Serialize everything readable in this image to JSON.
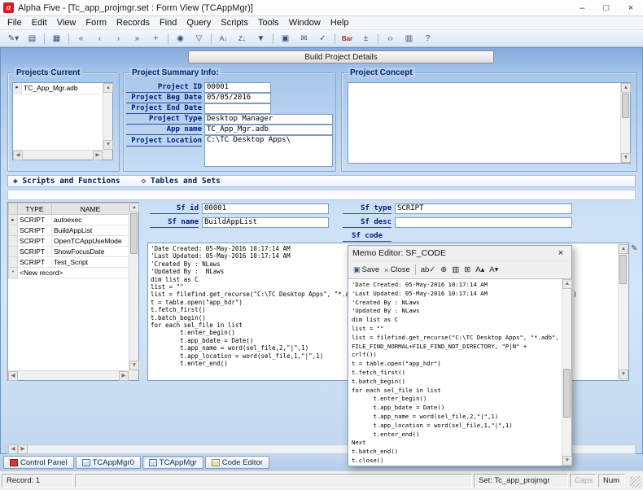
{
  "window": {
    "title": "Alpha Five - [Tc_app_projmgr.set : Form View (TCAppMgr)]",
    "logo_letter": "a",
    "minimize_glyph": "–",
    "maximize_glyph": "□",
    "close_glyph": "×"
  },
  "menu": {
    "items": [
      "File",
      "Edit",
      "View",
      "Form",
      "Records",
      "Find",
      "Query",
      "Scripts",
      "Tools",
      "Window",
      "Help"
    ]
  },
  "toolbar": {
    "icons": [
      {
        "name": "edit-mode",
        "glyph": "✎▾"
      },
      {
        "name": "open-form",
        "glyph": "▤"
      },
      {
        "name": "print",
        "glyph": "▦"
      },
      {
        "name": "first-record",
        "glyph": "«"
      },
      {
        "name": "previous-record",
        "glyph": "‹"
      },
      {
        "name": "next-record",
        "glyph": "›"
      },
      {
        "name": "last-record",
        "glyph": "»"
      },
      {
        "name": "new-record",
        "glyph": "+"
      },
      {
        "name": "find",
        "glyph": "◉"
      },
      {
        "name": "query",
        "glyph": "▽"
      },
      {
        "name": "sort-ascending",
        "glyph": "A↓"
      },
      {
        "name": "sort-descending",
        "glyph": "Z↓"
      },
      {
        "name": "filter",
        "glyph": "▼"
      },
      {
        "name": "image",
        "glyph": "▣"
      },
      {
        "name": "mail",
        "glyph": "✉"
      },
      {
        "name": "spellcheck",
        "glyph": "✓"
      },
      {
        "name": "bar",
        "glyph": "Bar"
      },
      {
        "name": "calculator",
        "glyph": "±"
      },
      {
        "name": "code",
        "glyph": "‹›"
      },
      {
        "name": "browse",
        "glyph": "▥"
      },
      {
        "name": "help",
        "glyph": "?"
      }
    ]
  },
  "build_button_label": "Build Project Details",
  "scroll": {
    "up": "▲",
    "down": "▼",
    "left": "◀",
    "right": "▶"
  },
  "projects_current": {
    "title": "Projects Current",
    "rows": [
      {
        "marker": "▸",
        "name": "TC_App_Mgr.adb"
      }
    ]
  },
  "project_summary": {
    "title": "Project Summary Info:",
    "project_id_label": "Project ID",
    "project_id": "00001",
    "beg_date_label": "Project Beg Date",
    "beg_date": "05/05/2016",
    "end_date_label": "Project End Date",
    "end_date": "",
    "type_label": "Project Type",
    "type_value": "Desktop Manager",
    "app_name_label": "App name",
    "app_name": "TC_App_Mgr.adb",
    "location_label": "Project Location",
    "location": "C:\\TC Desktop Apps\\"
  },
  "project_concept": {
    "title": "Project Concept",
    "content": ""
  },
  "section_selector": {
    "scripts_label": "◈ Scripts and Functions",
    "tables_label": "◇ Tables and Sets"
  },
  "scripts_browse": {
    "headers": {
      "type": "TYPE",
      "name": "NAME"
    },
    "rows": [
      {
        "marker": "▸",
        "type": "SCRIPT",
        "name": "autoexec"
      },
      {
        "marker": "",
        "type": "SCRIPT",
        "name": "BuildAppList"
      },
      {
        "marker": "",
        "type": "SCRIPT",
        "name": "OpenTCAppUseMode"
      },
      {
        "marker": "",
        "type": "SCRIPT",
        "name": "ShowFocusDate"
      },
      {
        "marker": "",
        "type": "SCRIPT",
        "name": "Test_Script"
      },
      {
        "marker": "*",
        "type": "<New record>",
        "name": ""
      }
    ]
  },
  "sf": {
    "id_label": "Sf id",
    "id_value": "00001",
    "type_label": "Sf type",
    "type_value": "SCRIPT",
    "name_label": "Sf name",
    "name_value": "BuildAppList",
    "desc_label": "Sf desc",
    "desc_value": "",
    "code_label": "Sf code",
    "edit_icon": "✎",
    "code": "'Date Created: 05-May-2016 10:17:14 AM\n'Last Updated: 05-May-2016 10:17:14 AM\n'Created By : NLaws\n'Updated By :  NLaws\ndim list as C\nlist = \"\"\nlist = filefind.get_recurse(\"C:\\TC Desktop Apps\", \"*.adb\", FILE_FIND_NORMAL+FILE_FIND_NOT_DIRECTORY, \"P|N\" + crlf())\nt = table.open(\"app_hdr\")\nt.fetch_first()\nt.batch_begin()\nfor each sel_file in list\n\tt.enter_begin()\n\tt.app_bdate = Date()\n\tt.app_name = word(sel_file,2,\"|\",1)\n\tt.app_location = word(sel_file,1,\"|\",1)\n\tt.enter_end()"
  },
  "memo_editor": {
    "title": "Memo Editor: SF_CODE",
    "close_x": "×",
    "save_label": "Save",
    "close_label": "Close",
    "icons": {
      "save": "▣",
      "close": "×",
      "spell": "ab✓",
      "zoom": "⊕",
      "paste": "▥",
      "copy": "⊞",
      "font_plus": "A▴",
      "font_minus": "A▾"
    },
    "content": "'Date Created: 05-May-2016 10:17:14 AM\n'Last Updated: 05-May-2016 10:17:14 AM\n'Created By : NLaws\n'Updated By : NLaws\ndim list as C\nlist = \"\"\nlist = filefind.get_recurse(\"C:\\TC Desktop Apps\", \"*.adb\",\nFILE_FIND_NORMAL+FILE_FIND_NOT_DIRECTORY, \"P|N\" +\ncrlf())\nt = table.open(\"app_hdr\")\nt.fetch_first()\nt.batch_begin()\nfor each sel_file in list\n\tt.enter_begin()\n\tt.app_bdate = Date()\n\tt.app_name = word(sel_file,2,\"|\",1)\n\tt.app_location = word(sel_file,1,\"|\",1)\n\tt.enter_end()\nNext\nt.batch_end()\nt.close()"
  },
  "bottom_tabs": {
    "items": [
      "Control Panel",
      "TCAppMgr0",
      "TCAppMgr",
      "Code Editor"
    ],
    "active": "TCAppMgr"
  },
  "status": {
    "record": "Record: 1",
    "set": "Set: Tc_app_projmgr",
    "caps": "Caps",
    "num": "Num"
  }
}
